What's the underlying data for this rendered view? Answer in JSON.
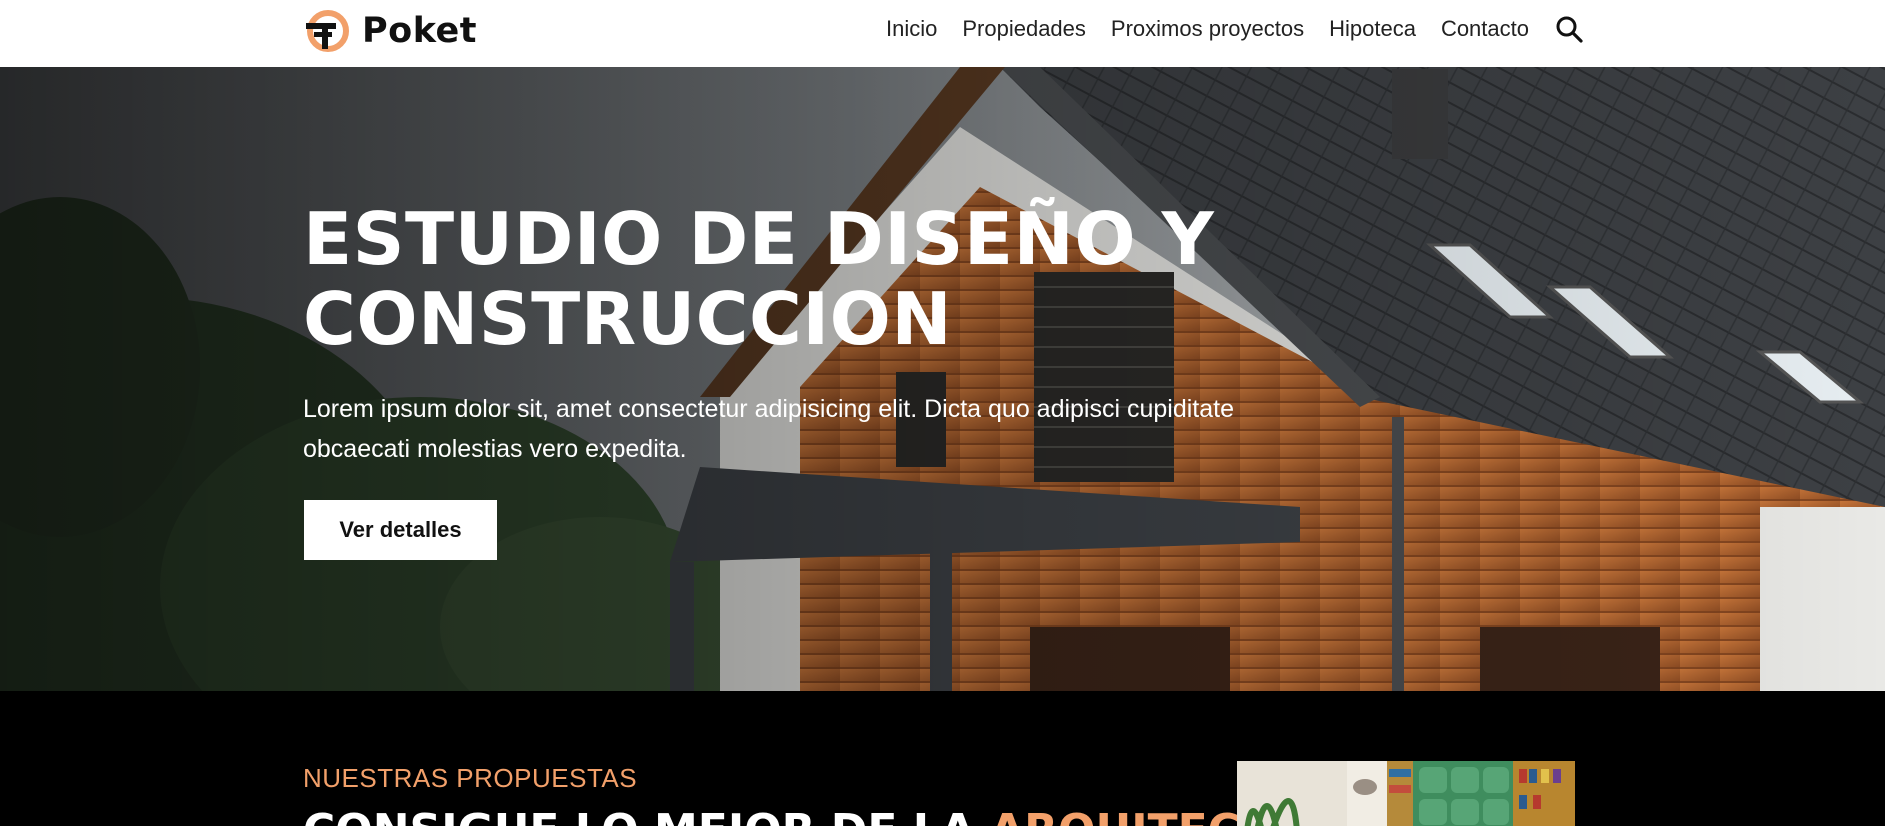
{
  "brand": {
    "name": "Poket",
    "accent_color": "#f2a06a",
    "logo_icon": "poket-logo-icon"
  },
  "nav": {
    "items": [
      {
        "label": "Inicio"
      },
      {
        "label": "Propiedades"
      },
      {
        "label": "Proximos proyectos"
      },
      {
        "label": "Hipoteca"
      },
      {
        "label": "Contacto"
      }
    ],
    "search_icon": "search-icon"
  },
  "hero": {
    "title": "ESTUDIO DE DISEÑO Y CONSTRUCCION",
    "text": "Lorem ipsum dolor sit, amet consectetur adipisicing elit. Dicta quo adipisci cupiditate obcaecati molestias vero expedita.",
    "button_label": "Ver detalles",
    "image": "house-photo"
  },
  "proposals": {
    "eyebrow": "NUESTRAS PROPUESTAS",
    "heading_main": "CONSIGUE LO MEJOR DE LA ",
    "heading_accent": "ARQUITECTURA",
    "image": "interior-photo"
  }
}
